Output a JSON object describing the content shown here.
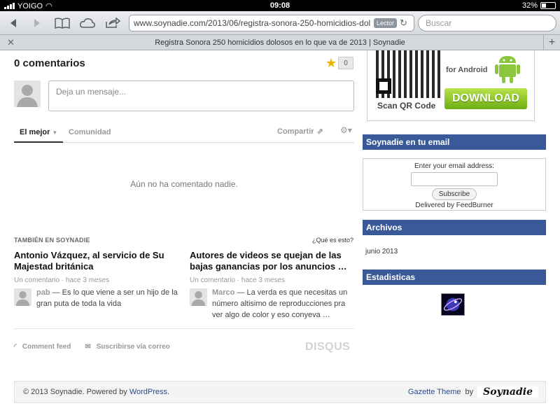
{
  "status": {
    "carrier": "YOIGO",
    "time": "09:08",
    "battery": "32%"
  },
  "toolbar": {
    "url": "www.soynadie.com/2013/06/registra-sonora-250-homicidios-dol",
    "reader_label": "Lector",
    "search_placeholder": "Buscar"
  },
  "tab": {
    "title": "Registra Sonora 250 homicidios dolosos en lo que va de 2013 | Soynadie"
  },
  "comments": {
    "title": "0 comentarios",
    "count": "0",
    "placeholder": "Deja un mensaje...",
    "sort_best": "El mejor",
    "community": "Comunidad",
    "share": "Compartir",
    "empty": "Aún no ha comentado nadie.",
    "also_on_label": "TAMBIÉN EN",
    "also_on_site": "SOYNADIE",
    "whats_this": "¿Qué es esto?"
  },
  "stories": [
    {
      "title": "Antonio Vázquez, al servicio de Su Majestad británica",
      "meta": "Un comentario · hace 3 meses",
      "user": "pab",
      "snippet": " — Es lo que viene a ser un hijo de la gran puta de toda la vida"
    },
    {
      "title": "Autores de videos se quejan de las bajas ganancias por los anuncios …",
      "meta": "Un comentario · hace 3 meses",
      "user": "Marco",
      "snippet": " — La verda es que necesitas un número altisimo de reproducciones pra ver algo de color y eso conyeva …"
    }
  ],
  "feeds": {
    "comment_feed": "Comment feed",
    "subscribe": "Suscribirse vía correo",
    "brand": "DISQUS"
  },
  "footer": {
    "copyright": "© 2013 Soynadie. Powered by ",
    "wordpress": "WordPress",
    "period": ".",
    "theme": "Gazette Theme",
    "by": "by",
    "signature": "Soynadie"
  },
  "sidebar": {
    "ad": {
      "for_android": "for Android",
      "scan": "Scan QR Code",
      "download": "DOWNLOAD"
    },
    "email_widget": {
      "title": "Soynadie en tu email",
      "label": "Enter your email address:",
      "button": "Subscribe",
      "delivered": "Delivered by",
      "feedburner": "FeedBurner"
    },
    "archives": {
      "title": "Archivos",
      "items": [
        "junio 2013"
      ]
    },
    "stats": {
      "title": "Estadisticas"
    }
  },
  "colors": {
    "widget_bar": "#3a5998",
    "link": "#2a4b8d",
    "star": "#e7b400"
  }
}
